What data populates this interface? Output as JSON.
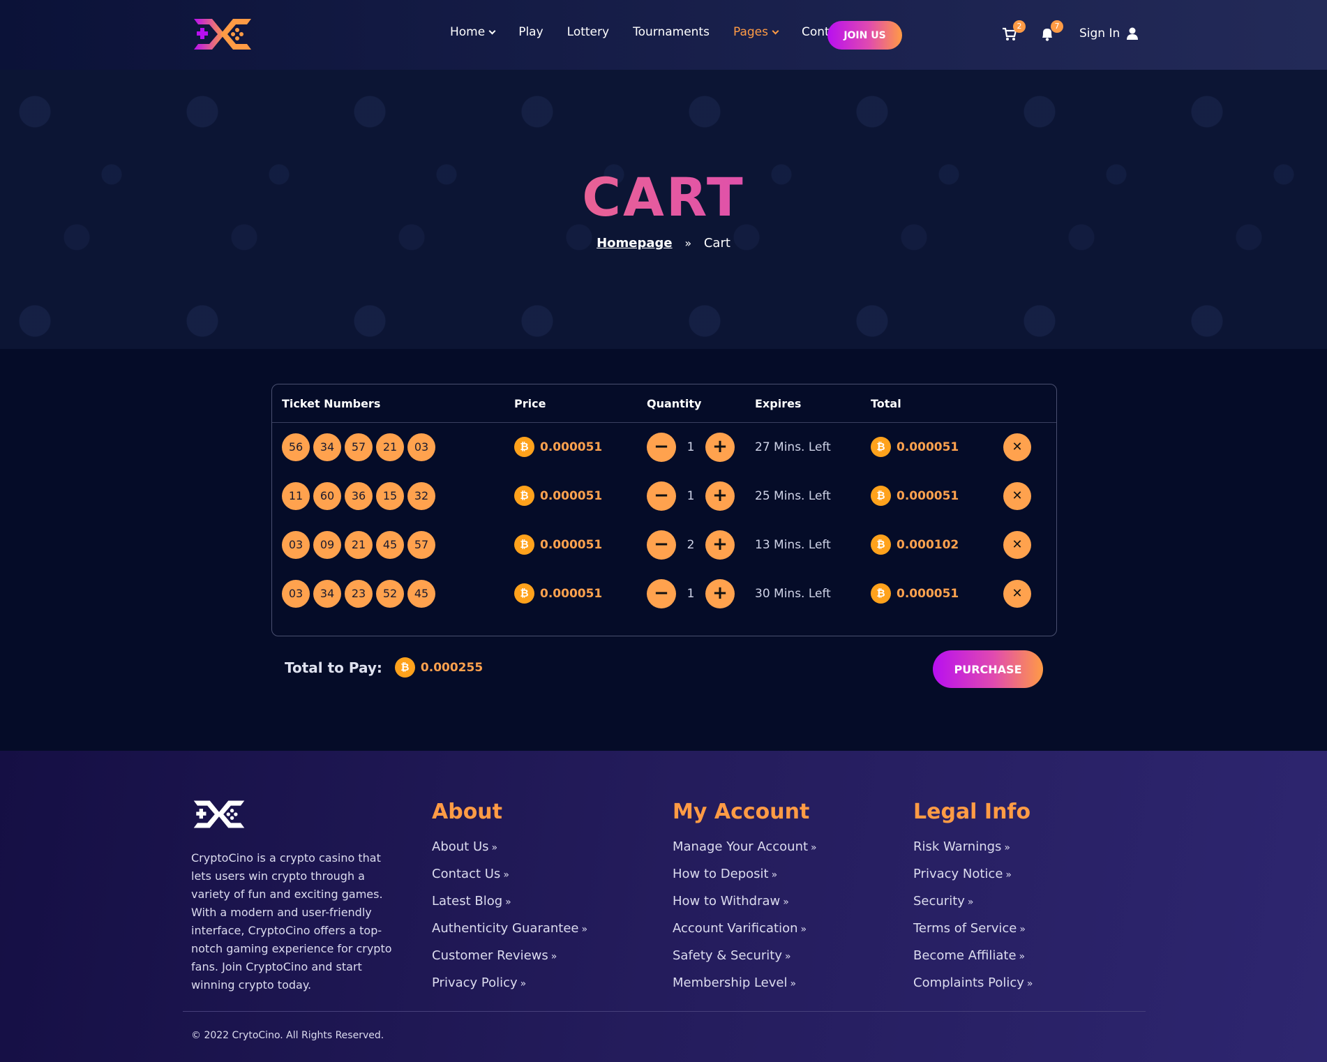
{
  "header": {
    "nav": [
      {
        "label": "Home",
        "dropdown": true,
        "active": false
      },
      {
        "label": "Play",
        "dropdown": false,
        "active": false
      },
      {
        "label": "Lottery",
        "dropdown": false,
        "active": false
      },
      {
        "label": "Tournaments",
        "dropdown": false,
        "active": false
      },
      {
        "label": "Pages",
        "dropdown": true,
        "active": true
      },
      {
        "label": "Contact",
        "dropdown": false,
        "active": false
      }
    ],
    "join_label": "JOIN US",
    "cart_count": "2",
    "notif_count": "7",
    "signin_label": "Sign In"
  },
  "hero": {
    "title": "CART",
    "breadcrumb_home": "Homepage",
    "breadcrumb_current": "Cart"
  },
  "cart": {
    "headers": {
      "tickets": "Ticket Numbers",
      "price": "Price",
      "quantity": "Quantity",
      "expires": "Expires",
      "total": "Total"
    },
    "rows": [
      {
        "numbers": [
          "56",
          "34",
          "57",
          "21",
          "03"
        ],
        "price": "0.000051",
        "qty": "1",
        "expires": "27 Mins. Left",
        "total": "0.000051"
      },
      {
        "numbers": [
          "11",
          "60",
          "36",
          "15",
          "32"
        ],
        "price": "0.000051",
        "qty": "1",
        "expires": "25 Mins. Left",
        "total": "0.000051"
      },
      {
        "numbers": [
          "03",
          "09",
          "21",
          "45",
          "57"
        ],
        "price": "0.000051",
        "qty": "2",
        "expires": "13 Mins. Left",
        "total": "0.000102"
      },
      {
        "numbers": [
          "03",
          "34",
          "23",
          "52",
          "45"
        ],
        "price": "0.000051",
        "qty": "1",
        "expires": "30 Mins. Left",
        "total": "0.000051"
      }
    ],
    "total_label": "Total to Pay:",
    "total_value": "0.000255",
    "purchase_label": "PURCHASE",
    "coin_symbol": "₿"
  },
  "footer": {
    "about_text": "CryptoCino is a crypto casino that lets users win crypto through a variety of fun and exciting games. With a modern and user-friendly interface, CryptoCino offers a top-notch gaming experience for crypto fans. Join CryptoCino and start winning crypto today.",
    "columns": [
      {
        "title": "About",
        "links": [
          "About Us",
          "Contact Us",
          "Latest Blog",
          "Authenticity Guarantee",
          "Customer Reviews",
          "Privacy Policy"
        ]
      },
      {
        "title": "My Account",
        "links": [
          "Manage Your Account",
          "How to Deposit",
          "How to Withdraw",
          "Account Varification",
          "Safety & Security",
          "Membership Level"
        ]
      },
      {
        "title": "Legal Info",
        "links": [
          "Risk Warnings",
          "Privacy Notice",
          "Security",
          "Terms of Service",
          "Become Affiliate",
          "Complaints Policy"
        ]
      }
    ],
    "copyright": "© 2022 CrytoCino. All Rights Reserved."
  },
  "colors": {
    "accent_orange": "#ffa24e",
    "accent_purple": "#b80ff0",
    "background": "#050c28"
  }
}
